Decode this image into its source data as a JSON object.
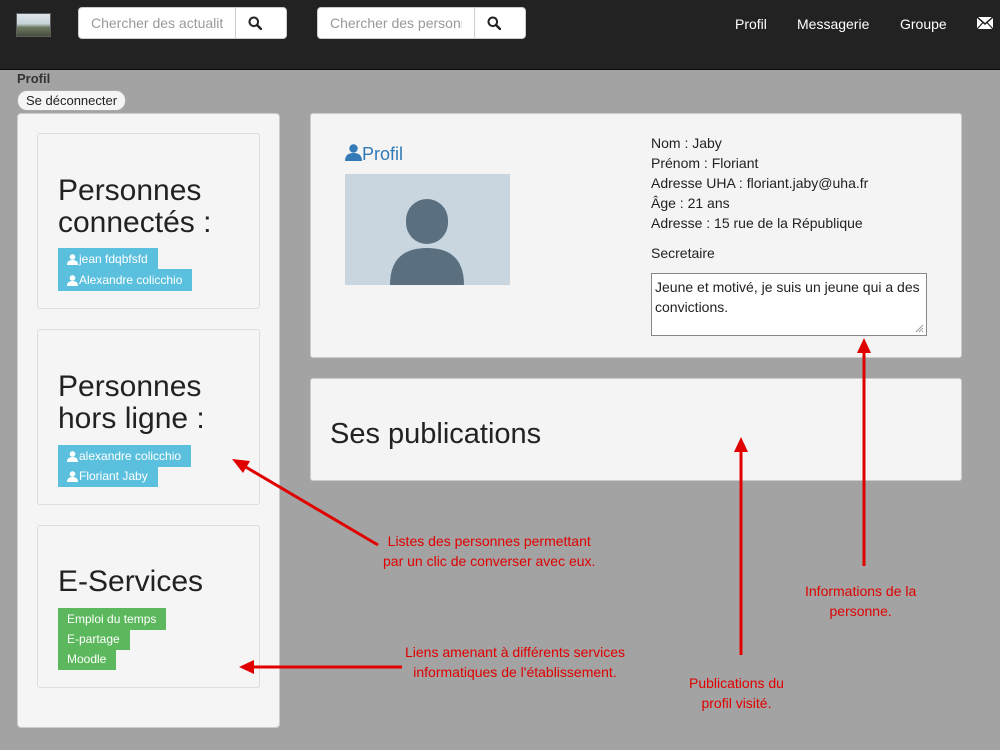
{
  "navbar": {
    "search_news": {
      "placeholder": "Chercher des actualités"
    },
    "search_people": {
      "placeholder": "Chercher des personnes"
    },
    "links": [
      "Profil",
      "Messagerie",
      "Groupe"
    ]
  },
  "page": {
    "label": "Profil",
    "logout": "Se déconnecter"
  },
  "sidebar": {
    "online": {
      "title_l1": "Personnes",
      "title_l2": "connectés :",
      "people": [
        "jean fdqbfsfd",
        "Alexandre colicchio"
      ]
    },
    "offline": {
      "title_l1": "Personnes",
      "title_l2": "hors ligne :",
      "people": [
        "alexandre colicchio",
        "Floriant Jaby"
      ]
    },
    "services": {
      "title": "E-Services",
      "links": [
        "Emploi du temps",
        "E-partage",
        "Moodle"
      ]
    }
  },
  "profile": {
    "heading": "Profil",
    "fields": [
      "Nom : Jaby",
      "Prénom : Floriant",
      "Adresse UHA : floriant.jaby@uha.fr",
      "Âge : 21 ans",
      "Adresse : 15 rue de la République"
    ],
    "role": "Secretaire",
    "bio": "Jeune et motivé, je suis un jeune qui a des convictions."
  },
  "publications": {
    "title": "Ses publications"
  },
  "annotations": {
    "people_l1": "Listes des personnes permettant",
    "people_l2": "par un clic de converser avec eux.",
    "services_l1": "Liens amenant à différents services",
    "services_l2": "informatiques de l'établissement.",
    "pubs_l1": "Publications du",
    "pubs_l2": "profil visité.",
    "info_l1": "Informations de la",
    "info_l2": "personne."
  },
  "colors": {
    "navbar": "#222222",
    "background": "#a3a3a3",
    "info_tag": "#5bc0de",
    "service_tag": "#5cb85c",
    "annotation": "#e00000",
    "link": "#337ab7"
  }
}
